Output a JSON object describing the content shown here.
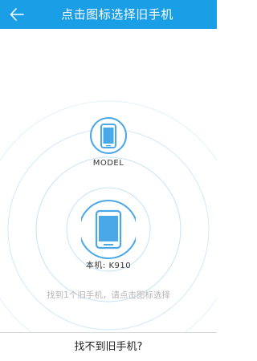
{
  "header": {
    "title": "点击图标选择旧手机",
    "back_icon": "arrow-left-icon"
  },
  "devices": [
    {
      "label": "MODEL",
      "icon": "phone-icon"
    },
    {
      "label": "本机: K910",
      "icon": "phone-icon"
    }
  ],
  "hint": "找到1个旧手机，请点击图标选择",
  "footer": {
    "label": "找不到旧手机?"
  },
  "colors": {
    "accent": "#1a9ee5",
    "ring": "#cfe8f7",
    "phone_fill": "#4aa7e8"
  }
}
